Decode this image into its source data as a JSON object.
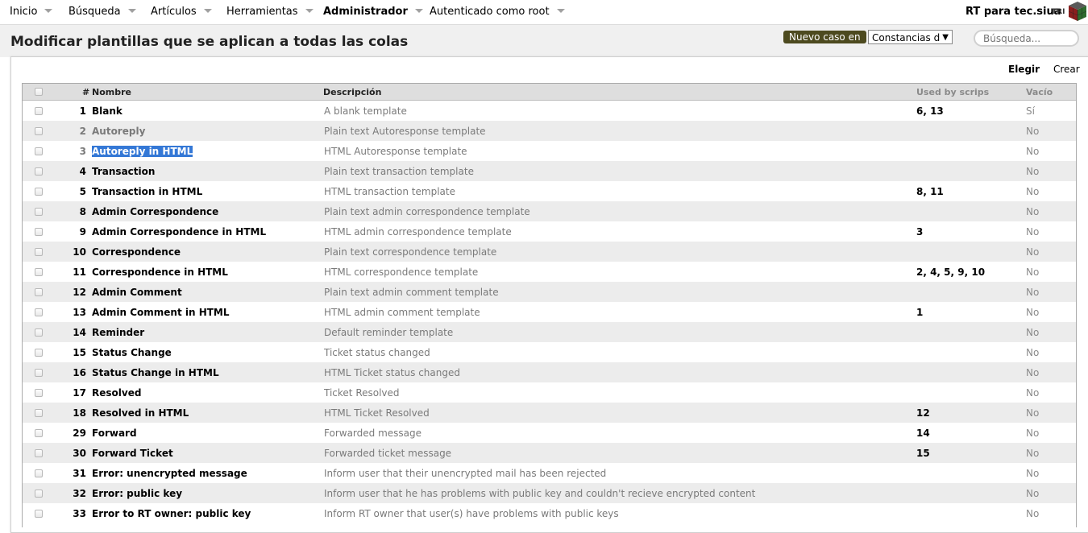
{
  "menu": {
    "items": [
      {
        "label": "Inicio",
        "bold": false
      },
      {
        "label": "Búsqueda",
        "bold": false
      },
      {
        "label": "Artículos",
        "bold": false
      },
      {
        "label": "Herramientas",
        "bold": false
      },
      {
        "label": "Administrador",
        "bold": true
      },
      {
        "label": "Autenticado como root",
        "bold": false
      }
    ],
    "rt_name": "RT para tec.siua",
    "logo_text": "TRI"
  },
  "header": {
    "title": "Modificar plantillas que se aplican a todas las colas",
    "new_ticket_label": "Nuevo caso en",
    "queue_selected": "Constancias d",
    "search_placeholder": "Búsqueda..."
  },
  "page_tabs": {
    "choose": "Elegir",
    "create": "Crear"
  },
  "table": {
    "columns": {
      "id": "#",
      "name": "Nombre",
      "description": "Descripción",
      "used_by_scrips": "Used by scrips",
      "empty": "Vacío"
    },
    "rows": [
      {
        "id": "1",
        "name": "Blank",
        "description": "A blank template",
        "scrips": "6, 13",
        "empty": "Sí",
        "dim": false,
        "selected": false
      },
      {
        "id": "2",
        "name": "Autoreply",
        "description": "Plain text Autoresponse template",
        "scrips": "",
        "empty": "No",
        "dim": true,
        "selected": false
      },
      {
        "id": "3",
        "name": "Autoreply in HTML",
        "description": "HTML Autoresponse template",
        "scrips": "",
        "empty": "No",
        "dim": true,
        "selected": true
      },
      {
        "id": "4",
        "name": "Transaction",
        "description": "Plain text transaction template",
        "scrips": "",
        "empty": "No",
        "dim": false,
        "selected": false
      },
      {
        "id": "5",
        "name": "Transaction in HTML",
        "description": "HTML transaction template",
        "scrips": "8, 11",
        "empty": "No",
        "dim": false,
        "selected": false
      },
      {
        "id": "8",
        "name": "Admin Correspondence",
        "description": "Plain text admin correspondence template",
        "scrips": "",
        "empty": "No",
        "dim": false,
        "selected": false
      },
      {
        "id": "9",
        "name": "Admin Correspondence in HTML",
        "description": "HTML admin correspondence template",
        "scrips": "3",
        "empty": "No",
        "dim": false,
        "selected": false
      },
      {
        "id": "10",
        "name": "Correspondence",
        "description": "Plain text correspondence template",
        "scrips": "",
        "empty": "No",
        "dim": false,
        "selected": false
      },
      {
        "id": "11",
        "name": "Correspondence in HTML",
        "description": "HTML correspondence template",
        "scrips": "2, 4, 5, 9, 10",
        "empty": "No",
        "dim": false,
        "selected": false
      },
      {
        "id": "12",
        "name": "Admin Comment",
        "description": "Plain text admin comment template",
        "scrips": "",
        "empty": "No",
        "dim": false,
        "selected": false
      },
      {
        "id": "13",
        "name": "Admin Comment in HTML",
        "description": "HTML admin comment template",
        "scrips": "1",
        "empty": "No",
        "dim": false,
        "selected": false
      },
      {
        "id": "14",
        "name": "Reminder",
        "description": "Default reminder template",
        "scrips": "",
        "empty": "No",
        "dim": false,
        "selected": false
      },
      {
        "id": "15",
        "name": "Status Change",
        "description": "Ticket status changed",
        "scrips": "",
        "empty": "No",
        "dim": false,
        "selected": false
      },
      {
        "id": "16",
        "name": "Status Change in HTML",
        "description": "HTML Ticket status changed",
        "scrips": "",
        "empty": "No",
        "dim": false,
        "selected": false
      },
      {
        "id": "17",
        "name": "Resolved",
        "description": "Ticket Resolved",
        "scrips": "",
        "empty": "No",
        "dim": false,
        "selected": false
      },
      {
        "id": "18",
        "name": "Resolved in HTML",
        "description": "HTML Ticket Resolved",
        "scrips": "12",
        "empty": "No",
        "dim": false,
        "selected": false
      },
      {
        "id": "29",
        "name": "Forward",
        "description": "Forwarded message",
        "scrips": "14",
        "empty": "No",
        "dim": false,
        "selected": false
      },
      {
        "id": "30",
        "name": "Forward Ticket",
        "description": "Forwarded ticket message",
        "scrips": "15",
        "empty": "No",
        "dim": false,
        "selected": false
      },
      {
        "id": "31",
        "name": "Error: unencrypted message",
        "description": "Inform user that their unencrypted mail has been rejected",
        "scrips": "",
        "empty": "No",
        "dim": false,
        "selected": false
      },
      {
        "id": "32",
        "name": "Error: public key",
        "description": "Inform user that he has problems with public key and couldn't recieve encrypted content",
        "scrips": "",
        "empty": "No",
        "dim": false,
        "selected": false
      },
      {
        "id": "33",
        "name": "Error to RT owner: public key",
        "description": "Inform RT owner that user(s) have problems with public keys",
        "scrips": "",
        "empty": "No",
        "dim": false,
        "selected": false
      }
    ]
  }
}
